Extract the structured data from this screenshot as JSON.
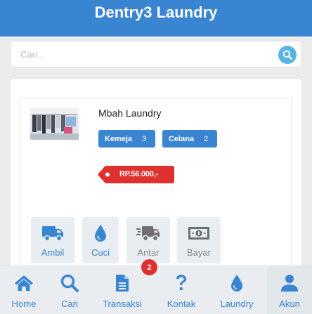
{
  "app": {
    "title": "Dentry3 Laundry"
  },
  "search": {
    "placeholder": "Cari..."
  },
  "order": {
    "customer_name": "Mbah Laundry",
    "items": [
      {
        "label": "Kemeja",
        "count": "3"
      },
      {
        "label": "Celana",
        "count": "2"
      }
    ],
    "price": "RP.56.000,-"
  },
  "actions": [
    {
      "label": "Ambil",
      "icon": "truck-icon",
      "color": "#3a85d1"
    },
    {
      "label": "Cuci",
      "icon": "drop-icon",
      "color": "#3a85d1"
    },
    {
      "label": "Antar",
      "icon": "fast-truck-icon",
      "color": "#888888"
    },
    {
      "label": "Bayar",
      "icon": "money-icon",
      "color": "#888888"
    }
  ],
  "badge": {
    "count": "2"
  },
  "nav": [
    {
      "label": "Home",
      "icon": "home-icon"
    },
    {
      "label": "Cari",
      "icon": "search-icon"
    },
    {
      "label": "Transaksi",
      "icon": "document-icon"
    },
    {
      "label": "Kontak",
      "icon": "question-icon"
    },
    {
      "label": "Laundry",
      "icon": "drop-icon"
    },
    {
      "label": "Akun",
      "icon": "user-icon"
    }
  ],
  "colors": {
    "primary": "#3a85d1",
    "danger": "#e03131",
    "muted": "#888888"
  }
}
